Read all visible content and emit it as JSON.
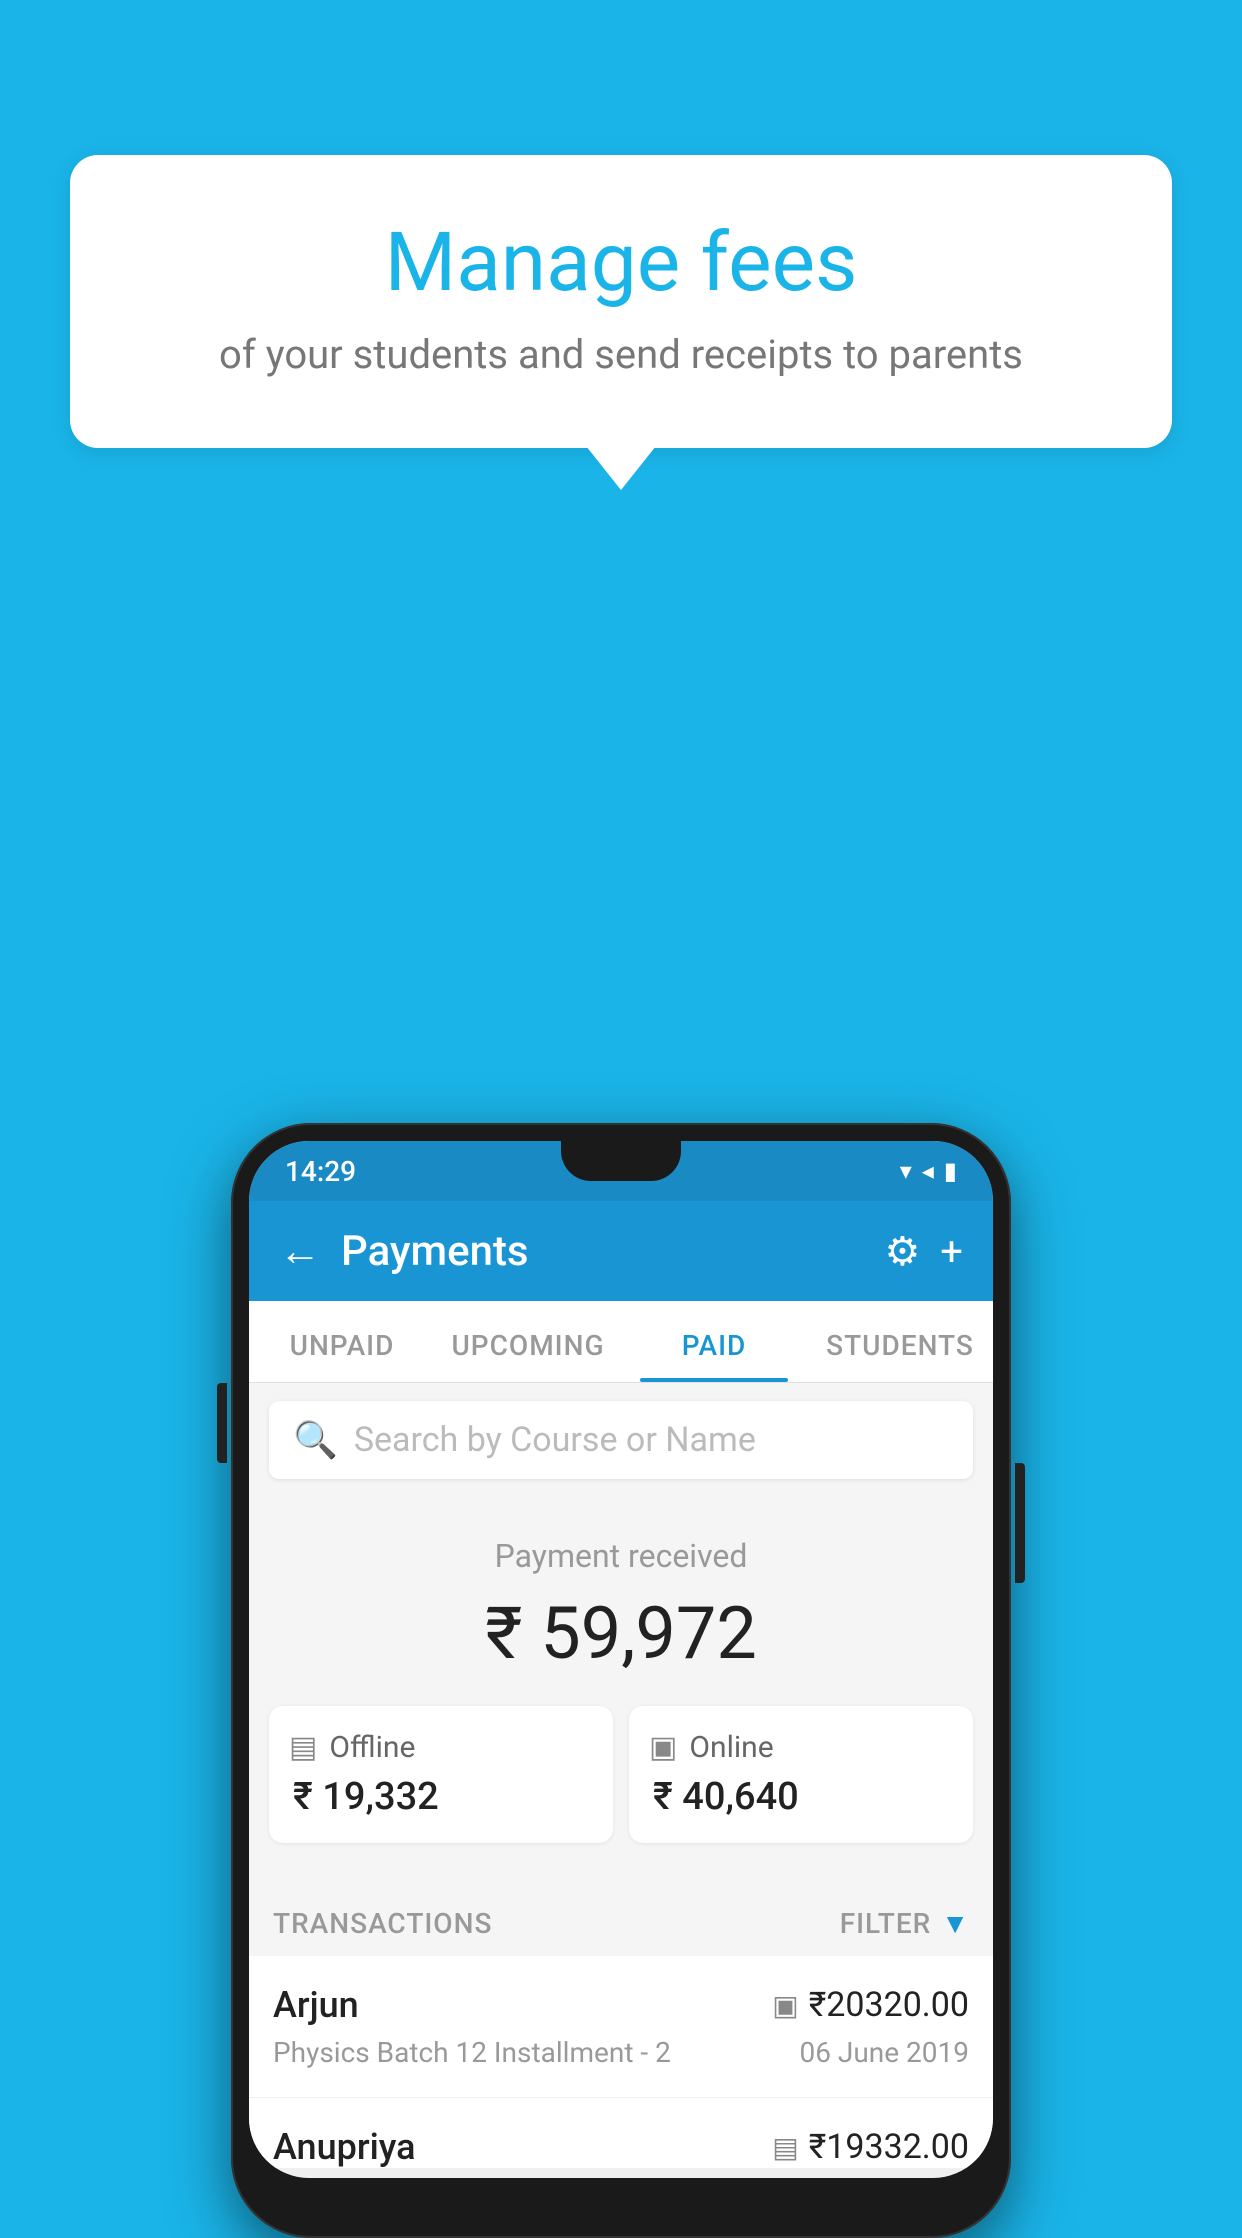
{
  "background_color": "#1ab4e8",
  "speech_bubble": {
    "title": "Manage fees",
    "subtitle": "of your students and send receipts to parents"
  },
  "phone": {
    "status_bar": {
      "time": "14:29",
      "icons": [
        "▾",
        "◂",
        "▮"
      ]
    },
    "app_bar": {
      "back_label": "←",
      "title": "Payments",
      "settings_icon": "⚙",
      "add_icon": "+"
    },
    "tabs": [
      {
        "label": "UNPAID",
        "active": false
      },
      {
        "label": "UPCOMING",
        "active": false
      },
      {
        "label": "PAID",
        "active": true
      },
      {
        "label": "STUDENTS",
        "active": false
      }
    ],
    "search": {
      "placeholder": "Search by Course or Name"
    },
    "payment_summary": {
      "received_label": "Payment received",
      "total_amount": "₹ 59,972",
      "offline_label": "Offline",
      "offline_amount": "₹ 19,332",
      "online_label": "Online",
      "online_amount": "₹ 40,640"
    },
    "transactions": {
      "section_label": "TRANSACTIONS",
      "filter_label": "FILTER",
      "items": [
        {
          "name": "Arjun",
          "payment_type_icon": "▣",
          "amount": "₹20320.00",
          "course": "Physics Batch 12 Installment - 2",
          "date": "06 June 2019"
        },
        {
          "name": "Anupriya",
          "payment_type_icon": "▤",
          "amount": "₹19332.00",
          "course": "",
          "date": ""
        }
      ]
    }
  }
}
